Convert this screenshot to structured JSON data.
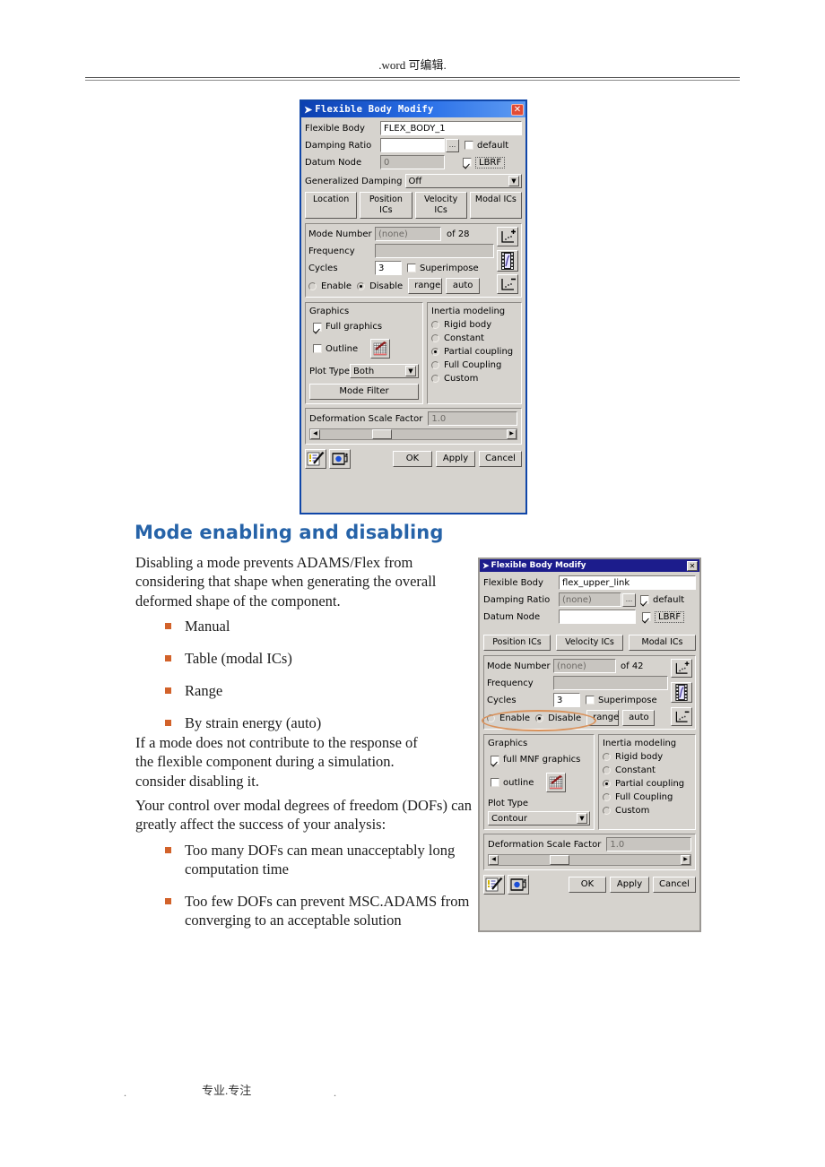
{
  "header": {
    "text": ".word 可编辑."
  },
  "footer": {
    "left_dot": ".",
    "center": "专业.专注",
    "right_dot": "."
  },
  "article": {
    "heading": "Mode enabling and disabling",
    "paragraph1": "Disabling a mode prevents ADAMS/Flex from considering that shape when generating the overall deformed shape of the component.",
    "bullets1": [
      "Manual",
      "Table (modal ICs)",
      "Range",
      "By strain energy (auto)"
    ],
    "paragraph2": "If a mode does not contribute to the response of the flexible component during a simulation. consider disabling it.",
    "paragraph3": "Your control over modal degrees of freedom (DOFs) can greatly affect the success of your analysis:",
    "bullets2": [
      "Too many DOFs can mean unacceptably long computation time",
      "Too few DOFs can prevent MSC.ADAMS from converging to an acceptable solution"
    ]
  },
  "colors": {
    "heading_blue": "#2663a8",
    "bullet_orange": "#d2622a",
    "titlebar_blue_1": "#0b3fb0",
    "titlebar_blue_2": "#1c1c8c",
    "dialog_face": "#d6d3ce",
    "highlight_ellipse": "#d9915a",
    "close_red": "#e24b35"
  },
  "dialog1": {
    "title": "Flexible Body Modify",
    "close_label": "✕",
    "fields": {
      "flexible_body_label": "Flexible Body",
      "flexible_body_value": "FLEX_BODY_1",
      "damping_ratio_label": "Damping Ratio",
      "damping_ratio_value": "",
      "browse_label": "...",
      "default_label": "default",
      "default_checked": false,
      "datum_node_label": "Datum Node",
      "datum_node_value": "0",
      "lbrf_label": "LBRF",
      "lbrf_checked": true,
      "gen_damping_label": "Generalized Damping",
      "gen_damping_value": "Off"
    },
    "tabs": [
      "Location",
      "Position ICs",
      "Velocity ICs",
      "Modal ICs"
    ],
    "mode": {
      "mode_number_label": "Mode Number",
      "mode_number_value": "(none)",
      "of_label": "of 28",
      "frequency_label": "Frequency",
      "frequency_value": "",
      "cycles_label": "Cycles",
      "cycles_value": "3",
      "superimpose_label": "Superimpose",
      "superimpose_checked": false,
      "enable_label": "Enable",
      "disable_label": "Disable",
      "enable_selected": false,
      "disable_selected": true,
      "range_label": "range",
      "auto_label": "auto",
      "icon_plus": "mode-increment-icon",
      "icon_film": "animate-film-icon",
      "icon_minus": "mode-decrement-icon"
    },
    "graphics": {
      "group_label": "Graphics",
      "full_graphics_label": "Full graphics",
      "full_graphics_checked": true,
      "outline_label": "Outline",
      "outline_checked": false,
      "plot_type_label": "Plot Type",
      "plot_type_value": "Both",
      "mode_filter_label": "Mode Filter",
      "contour_icon": "contour-plot-icon"
    },
    "inertia": {
      "group_label": "Inertia modeling",
      "options": [
        "Rigid body",
        "Constant",
        "Partial coupling",
        "Full Coupling",
        "Custom"
      ],
      "selected": "Partial coupling"
    },
    "deformation": {
      "label": "Deformation Scale Factor",
      "value": "1.0"
    },
    "footer": {
      "ok_label": "OK",
      "apply_label": "Apply",
      "cancel_label": "Cancel",
      "icon_edit": "edit-note-icon",
      "icon_flexbody": "flexible-body-icon"
    }
  },
  "dialog2": {
    "title": "Flexible Body Modify",
    "close_label": "✕",
    "fields": {
      "flexible_body_label": "Flexible Body",
      "flexible_body_value": "flex_upper_link",
      "damping_ratio_label": "Damping Ratio",
      "damping_ratio_value": "(none)",
      "browse_label": "...",
      "default_label": "default",
      "default_checked": true,
      "datum_node_label": "Datum Node",
      "datum_node_value": "",
      "lbrf_label": "LBRF",
      "lbrf_checked": true
    },
    "tabs": [
      "Position ICs",
      "Velocity ICs",
      "Modal ICs"
    ],
    "mode": {
      "mode_number_label": "Mode Number",
      "mode_number_value": "(none)",
      "of_label": "of 42",
      "frequency_label": "Frequency",
      "frequency_value": "",
      "cycles_label": "Cycles",
      "cycles_value": "3",
      "superimpose_label": "Superimpose",
      "superimpose_checked": false,
      "enable_label": "Enable",
      "disable_label": "Disable",
      "enable_selected": false,
      "disable_selected": true,
      "range_label": "range",
      "auto_label": "auto",
      "icon_plus": "mode-increment-icon",
      "icon_film": "animate-film-icon",
      "icon_minus": "mode-decrement-icon"
    },
    "graphics": {
      "group_label": "Graphics",
      "full_graphics_label": "full MNF graphics",
      "full_graphics_checked": true,
      "outline_label": "outline",
      "outline_checked": false,
      "plot_type_label": "Plot Type",
      "plot_type_value": "Contour",
      "contour_icon": "contour-plot-icon"
    },
    "inertia": {
      "group_label": "Inertia modeling",
      "options": [
        "Rigid body",
        "Constant",
        "Partial coupling",
        "Full Coupling",
        "Custom"
      ],
      "selected": "Partial coupling"
    },
    "deformation": {
      "label": "Deformation Scale Factor",
      "value": "1.0"
    },
    "footer": {
      "ok_label": "OK",
      "apply_label": "Apply",
      "cancel_label": "Cancel",
      "icon_edit": "edit-note-icon",
      "icon_flexbody": "flexible-body-icon"
    }
  }
}
